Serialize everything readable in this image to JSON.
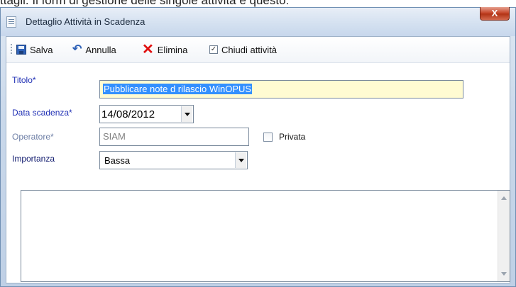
{
  "page_caption": "ttagli. Il form di gestione delle singole attività è questo:",
  "window": {
    "title": "Dettaglio Attività in Scadenza",
    "close_label": "X"
  },
  "toolbar": {
    "save_label": "Salva",
    "cancel_label": "Annulla",
    "delete_label": "Elimina",
    "close_activity_label": "Chiudi attività",
    "close_activity_checked": true
  },
  "form": {
    "titolo_label": "Titolo*",
    "titolo_value": "Pubblicare note d rilascio WinOPUS",
    "data_label": "Data scadenza*",
    "data_value": "14/08/2012",
    "operatore_label": "Operatore*",
    "operatore_value": "SIAM",
    "privata_label": "Privata",
    "privata_checked": false,
    "importanza_label": "Importanza",
    "importanza_value": "Bassa",
    "notes_value": ""
  },
  "colors": {
    "title_field_bg": "#fffbd2",
    "selection": "#3390ff",
    "delete_icon": "#e01010",
    "close_button": "#c7482d"
  },
  "icons": [
    "document-icon",
    "save-icon",
    "undo-icon",
    "delete-icon",
    "checkbox-icon",
    "dropdown-arrow-icon"
  ]
}
